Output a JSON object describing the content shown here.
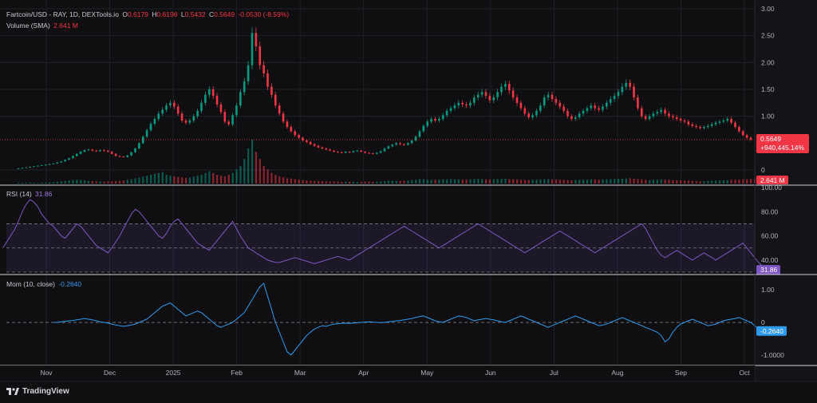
{
  "header": {
    "pair": "Fartcoin/USD - RAY, 1D, DEXTools.io",
    "open_key": "O",
    "open": "0.6179",
    "high_key": "H",
    "high": "0.6196",
    "low_key": "L",
    "low": "0.5432",
    "close_key": "C",
    "close": "0.5649",
    "change": "-0.0530 (-8.59%)"
  },
  "volume_legend": {
    "label": "Volume (SMA)",
    "value": "2.641 M"
  },
  "rsi_legend": {
    "label": "RSI (14)",
    "value": "31.86"
  },
  "mom_legend": {
    "label": "Mom (10, close)",
    "value": "-0.2640"
  },
  "price_badge": {
    "price": "0.5649",
    "change": "+940,445.14%"
  },
  "volume_badge": "2.641 M",
  "rsi_badge": "31.86",
  "mom_badge": "-0.2640",
  "brand": "TradingView",
  "colors": {
    "up": "#089981",
    "down": "#f23645",
    "rsi": "#7e57c2",
    "mom": "#2f9bf0",
    "background": "#0f0f12",
    "grid": "#1e2028"
  },
  "chart_data": {
    "type": "candlestick",
    "x_ticks": [
      "Nov",
      "Dec",
      "2025",
      "Feb",
      "Mar",
      "Apr",
      "May",
      "Jun",
      "Jul",
      "Aug",
      "Sep",
      "Oct"
    ],
    "price": {
      "y_ticks": [
        "3.00",
        "2.50",
        "2.00",
        "1.50",
        "1.00",
        "0"
      ],
      "ylim": [
        0,
        3.0
      ],
      "last": 0.5649,
      "close_series": [
        0.03,
        0.04,
        0.05,
        0.06,
        0.07,
        0.08,
        0.09,
        0.1,
        0.11,
        0.12,
        0.14,
        0.16,
        0.19,
        0.22,
        0.26,
        0.3,
        0.34,
        0.37,
        0.38,
        0.36,
        0.35,
        0.37,
        0.36,
        0.34,
        0.3,
        0.26,
        0.25,
        0.24,
        0.27,
        0.33,
        0.4,
        0.5,
        0.62,
        0.74,
        0.86,
        0.95,
        1.05,
        1.12,
        1.2,
        1.25,
        1.18,
        1.05,
        0.92,
        0.88,
        0.92,
        1.0,
        1.1,
        1.25,
        1.4,
        1.5,
        1.38,
        1.22,
        1.08,
        0.9,
        0.85,
        1.02,
        1.2,
        1.45,
        1.65,
        1.95,
        2.55,
        2.3,
        1.95,
        1.8,
        1.55,
        1.4,
        1.2,
        1.05,
        0.9,
        0.8,
        0.72,
        0.65,
        0.6,
        0.55,
        0.52,
        0.48,
        0.45,
        0.42,
        0.4,
        0.38,
        0.36,
        0.34,
        0.33,
        0.32,
        0.34,
        0.33,
        0.35,
        0.36,
        0.34,
        0.32,
        0.31,
        0.3,
        0.32,
        0.35,
        0.4,
        0.44,
        0.47,
        0.5,
        0.48,
        0.47,
        0.5,
        0.55,
        0.62,
        0.72,
        0.82,
        0.9,
        0.95,
        0.92,
        0.95,
        1.02,
        1.1,
        1.15,
        1.2,
        1.25,
        1.22,
        1.2,
        1.25,
        1.35,
        1.4,
        1.45,
        1.38,
        1.3,
        1.35,
        1.45,
        1.55,
        1.6,
        1.48,
        1.35,
        1.25,
        1.15,
        1.05,
        0.98,
        1.02,
        1.1,
        1.2,
        1.35,
        1.4,
        1.32,
        1.25,
        1.18,
        1.1,
        1.0,
        0.95,
        0.98,
        1.05,
        1.1,
        1.15,
        1.2,
        1.15,
        1.12,
        1.18,
        1.25,
        1.32,
        1.38,
        1.45,
        1.55,
        1.62,
        1.55,
        1.35,
        1.15,
        1.0,
        0.95,
        1.0,
        1.05,
        1.08,
        1.12,
        1.05,
        1.0,
        0.98,
        0.95,
        0.92,
        0.9,
        0.85,
        0.82,
        0.8,
        0.78,
        0.8,
        0.82,
        0.85,
        0.88,
        0.9,
        0.92,
        0.95,
        0.88,
        0.8,
        0.72,
        0.65,
        0.6,
        0.5649
      ]
    },
    "volume": {
      "last": "2.641 M",
      "series": [
        0.5,
        0.4,
        0.5,
        0.6,
        0.5,
        0.4,
        0.5,
        0.6,
        0.7,
        0.8,
        1,
        1.2,
        1.5,
        1.8,
        2,
        2.2,
        2,
        1.8,
        1.5,
        1.4,
        1.3,
        1.2,
        1.1,
        1.2,
        1.3,
        1.4,
        1.5,
        1.8,
        2.2,
        2.5,
        3,
        3.5,
        4,
        4.5,
        5,
        5.5,
        6,
        6.5,
        5,
        4.5,
        4,
        3.8,
        3.5,
        3.2,
        3.5,
        4,
        4.5,
        5,
        6,
        7,
        6,
        5,
        4.5,
        4,
        5,
        6,
        8,
        10,
        14,
        20,
        25,
        18,
        14,
        10,
        8,
        6,
        5,
        4,
        3.5,
        3,
        2.8,
        2.5,
        2.3,
        2,
        1.8,
        1.6,
        1.5,
        1.4,
        1.3,
        1.2,
        1.1,
        1.2,
        1.1,
        1,
        1,
        1.1,
        1,
        0.9,
        1,
        1.1,
        1.2,
        1.1,
        1,
        1.2,
        1.4,
        1.6,
        1.5,
        1.4,
        1.5,
        1.6,
        1.8,
        2,
        2.2,
        2.5,
        2.4,
        2.2,
        2,
        2.1,
        2.2,
        2.3,
        2.4,
        2.5,
        2.4,
        2.3,
        2.2,
        2.3,
        2.4,
        2.5,
        2.6,
        2.5,
        2.4,
        2.3,
        2.4,
        2.5,
        2.6,
        2.7,
        2.5,
        2.4,
        2.3,
        2.2,
        2.1,
        2,
        2.1,
        2.2,
        2.3,
        2.4,
        2.5,
        2.4,
        2.3,
        2.2,
        2.1,
        2,
        1.9,
        2,
        2.1,
        2.2,
        2.3,
        2.4,
        2.3,
        2.2,
        2.3,
        2.4,
        2.5,
        2.6,
        2.7,
        2.8,
        2.9,
        3,
        2.8,
        2.6,
        2.4,
        2.2,
        2,
        2.1,
        2.2,
        2.3,
        2.2,
        2.1,
        2,
        1.9,
        1.8,
        1.7,
        1.6,
        1.5,
        1.4,
        1.3,
        1.4,
        1.5,
        1.6,
        1.7,
        1.8,
        1.9,
        2,
        2.1,
        2.2,
        2.3,
        2.4,
        2.5,
        2.6,
        2.641
      ]
    },
    "rsi": {
      "y_ticks": [
        "100.00",
        "80.00",
        "60.00",
        "40.00"
      ],
      "ylim": [
        30,
        100
      ],
      "bands": [
        70,
        50,
        30
      ],
      "last": 31.86,
      "series": [
        50,
        55,
        60,
        65,
        72,
        80,
        86,
        90,
        88,
        84,
        78,
        74,
        70,
        68,
        64,
        60,
        58,
        62,
        66,
        70,
        68,
        64,
        60,
        56,
        52,
        50,
        48,
        46,
        50,
        55,
        60,
        66,
        72,
        78,
        82,
        80,
        76,
        72,
        68,
        64,
        60,
        58,
        62,
        68,
        72,
        74,
        70,
        66,
        62,
        58,
        54,
        52,
        50,
        48,
        52,
        56,
        60,
        64,
        68,
        72,
        66,
        60,
        55,
        50,
        48,
        46,
        44,
        42,
        40,
        39,
        38,
        38,
        39,
        40,
        41,
        42,
        41,
        40,
        39,
        38,
        37,
        38,
        39,
        40,
        41,
        42,
        43,
        42,
        41,
        40,
        42,
        44,
        46,
        48,
        50,
        52,
        54,
        56,
        58,
        60,
        62,
        64,
        66,
        68,
        66,
        64,
        62,
        60,
        58,
        56,
        54,
        52,
        50,
        52,
        54,
        56,
        58,
        60,
        62,
        64,
        66,
        68,
        70,
        68,
        66,
        64,
        62,
        60,
        58,
        56,
        54,
        52,
        50,
        48,
        46,
        48,
        50,
        52,
        54,
        56,
        58,
        60,
        62,
        64,
        62,
        60,
        58,
        56,
        54,
        52,
        50,
        48,
        46,
        48,
        50,
        52,
        54,
        56,
        58,
        60,
        62,
        64,
        66,
        68,
        70,
        66,
        60,
        54,
        48,
        44,
        42,
        44,
        46,
        48,
        46,
        44,
        42,
        40,
        42,
        44,
        46,
        44,
        42,
        40,
        42,
        44,
        46,
        48,
        50,
        52,
        54,
        50,
        46,
        42,
        38,
        35,
        31.86
      ]
    },
    "momentum": {
      "y_ticks": [
        "1.00",
        "0",
        "-1.0000"
      ],
      "ylim": [
        -1.2,
        1.3
      ],
      "last": -0.264,
      "series": [
        0,
        0,
        0.02,
        0.03,
        0.05,
        0.06,
        0.08,
        0.1,
        0.12,
        0.1,
        0.08,
        0.05,
        0.02,
        0,
        -0.02,
        -0.05,
        -0.08,
        -0.1,
        -0.12,
        -0.1,
        -0.08,
        -0.05,
        0,
        0.05,
        0.1,
        0.2,
        0.3,
        0.4,
        0.5,
        0.55,
        0.6,
        0.5,
        0.4,
        0.3,
        0.2,
        0.25,
        0.3,
        0.35,
        0.3,
        0.2,
        0.1,
        0,
        -0.1,
        -0.15,
        -0.1,
        -0.05,
        0,
        0.1,
        0.2,
        0.3,
        0.5,
        0.7,
        0.9,
        1.1,
        1.2,
        0.8,
        0.4,
        0,
        -0.3,
        -0.6,
        -0.9,
        -1.0,
        -0.85,
        -0.7,
        -0.55,
        -0.4,
        -0.3,
        -0.2,
        -0.15,
        -0.1,
        -0.12,
        -0.08,
        -0.05,
        -0.04,
        -0.03,
        -0.02,
        -0.03,
        -0.02,
        -0.01,
        0,
        0.01,
        0.02,
        0.01,
        0,
        -0.01,
        0,
        0.02,
        0.03,
        0.05,
        0.06,
        0.08,
        0.1,
        0.12,
        0.15,
        0.18,
        0.2,
        0.15,
        0.1,
        0.05,
        0.02,
        0,
        0.05,
        0.1,
        0.15,
        0.2,
        0.18,
        0.15,
        0.1,
        0.05,
        0.08,
        0.1,
        0.12,
        0.1,
        0.08,
        0.05,
        0.02,
        0,
        0.05,
        0.1,
        0.15,
        0.2,
        0.15,
        0.1,
        0.05,
        0,
        -0.05,
        -0.1,
        -0.15,
        -0.1,
        -0.05,
        0,
        0.05,
        0.1,
        0.15,
        0.2,
        0.15,
        0.1,
        0.05,
        0,
        -0.05,
        -0.1,
        -0.08,
        -0.05,
        0,
        0.05,
        0.1,
        0.15,
        0.1,
        0.05,
        0,
        -0.05,
        -0.1,
        -0.15,
        -0.2,
        -0.25,
        -0.3,
        -0.4,
        -0.6,
        -0.5,
        -0.3,
        -0.15,
        -0.05,
        0,
        0.05,
        0.1,
        0.05,
        0,
        -0.05,
        -0.1,
        -0.08,
        -0.05,
        0,
        0.05,
        0.08,
        0.1,
        0.12,
        0.15,
        0.1,
        0.05,
        0,
        -0.1,
        -0.2,
        -0.25,
        -0.264
      ]
    }
  }
}
